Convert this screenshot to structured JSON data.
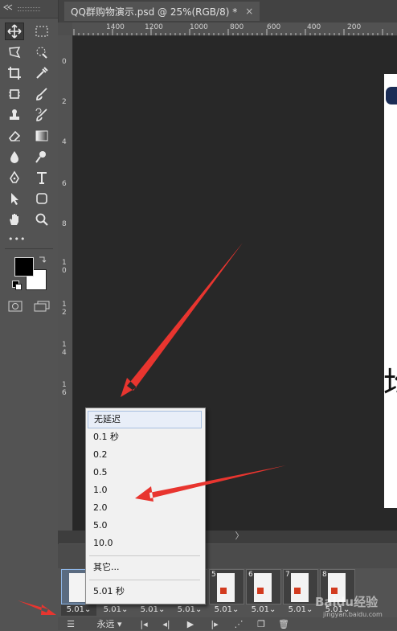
{
  "document": {
    "tab_title": "QQ群购物演示.psd @ 25%(RGB/8) *",
    "close_label": "×",
    "canvas_glyph": "均"
  },
  "rulers": {
    "top": [
      "1400",
      "1200",
      "1000",
      "800",
      "600",
      "400",
      "200"
    ],
    "left": [
      "0",
      "2",
      "4",
      "6",
      "8",
      "1 0",
      "1 2",
      "1 4",
      "1 6"
    ]
  },
  "toolbar": {
    "more_tools": "•••",
    "tools": [
      "move-icon",
      "marquee-icon",
      "lasso-icon",
      "quick-select-icon",
      "crop-icon",
      "eyedropper-icon",
      "frame-icon",
      "brush-icon",
      "stamp-icon",
      "history-brush-icon",
      "eraser-icon",
      "gradient-icon",
      "blur-icon",
      "dodge-icon",
      "pen-icon",
      "type-icon",
      "path-select-icon",
      "shape-icon",
      "hand-icon",
      "zoom-icon"
    ]
  },
  "menu": {
    "items": [
      "无延迟",
      "0.1 秒",
      "0.2",
      "0.5",
      "1.0",
      "2.0",
      "5.0",
      "10.0"
    ],
    "other": "其它...",
    "current": "5.01 秒",
    "highlighted_index": 0
  },
  "timeline": {
    "frames": [
      {
        "num": "",
        "delay": "5.01"
      },
      {
        "num": "",
        "delay": "5.01"
      },
      {
        "num": "",
        "delay": "5.01"
      },
      {
        "num": "",
        "delay": "5.01"
      },
      {
        "num": "5",
        "delay": "5.01"
      },
      {
        "num": "6",
        "delay": "5.01"
      },
      {
        "num": "7",
        "delay": "5.01"
      },
      {
        "num": "8",
        "delay": "5.01"
      }
    ],
    "loop_label": "永远",
    "scroll_arrow": "〉"
  },
  "watermark": {
    "text": "Baidu经验",
    "url": "jingyan.baidu.com"
  },
  "colors": {
    "panel": "#535353",
    "canvas": "#282828",
    "arrow": "#e8352f",
    "menu_bg": "#f1f1f1",
    "highlight": "#e8eef8"
  }
}
